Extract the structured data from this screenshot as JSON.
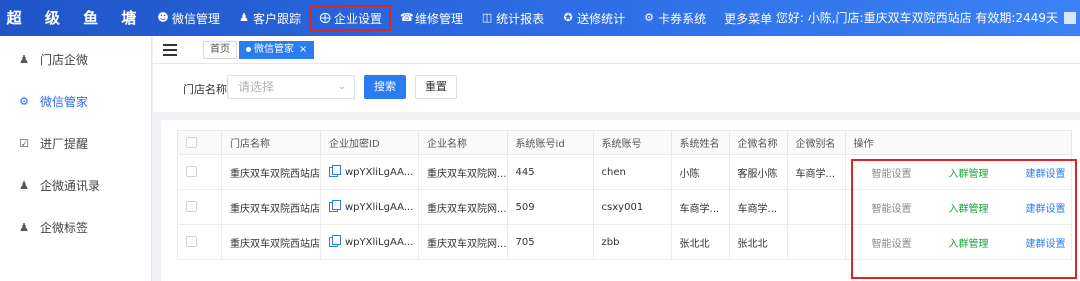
{
  "app": {
    "brand": "超 级 鱼 塘"
  },
  "nav": [
    {
      "label": "微信管理",
      "icon": "users-icon"
    },
    {
      "label": "客户跟踪",
      "icon": "user-icon"
    },
    {
      "label": "企业设置",
      "icon": "plus-circle-icon"
    },
    {
      "label": "维修管理",
      "icon": "wrench-icon"
    },
    {
      "label": "统计报表",
      "icon": "report-icon"
    },
    {
      "label": "送修统计",
      "icon": "share-icon"
    },
    {
      "label": "卡券系统",
      "icon": "ticket-icon"
    },
    {
      "label": "更多菜单",
      "icon": ""
    }
  ],
  "header": {
    "greeting": "您好: 小陈,门店:重庆双车双院西站店 有效期:2449天"
  },
  "sidebar": {
    "items": [
      {
        "label": "门店企微",
        "icon": "person-icon"
      },
      {
        "label": "微信管家",
        "icon": "gear-icon"
      },
      {
        "label": "进厂提醒",
        "icon": "checkbox-icon"
      },
      {
        "label": "企微通讯录",
        "icon": "contacts-icon"
      },
      {
        "label": "企微标签",
        "icon": "tag-icon"
      }
    ]
  },
  "tabs": [
    {
      "label": "首页"
    },
    {
      "label": "微信管家",
      "close": "×"
    }
  ],
  "filter": {
    "label": "门店名称",
    "placeholder": "请选择",
    "search_label": "搜索",
    "reset_label": "重置"
  },
  "table": {
    "columns": [
      "门店名称",
      "企业加密ID",
      "企业名称",
      "系统账号id",
      "系统账号",
      "系统姓名",
      "企微名称",
      "企微别名",
      "操作"
    ],
    "rows": [
      {
        "store": "重庆双车双院西站店",
        "corp_id": "wpYXliLgAA...",
        "corp_name": "重庆双车双院网...",
        "account_id": "445",
        "account": "chen",
        "name": "小陈",
        "wecom_name": "客服小陈",
        "wecom_alias": "车商学..."
      },
      {
        "store": "重庆双车双院西站店",
        "corp_id": "wpYXliLgAA...",
        "corp_name": "重庆双车双院网...",
        "account_id": "509",
        "account": "csxy001",
        "name": "车商学...",
        "wecom_name": "车商学...",
        "wecom_alias": ""
      },
      {
        "store": "重庆双车双院西站店",
        "corp_id": "wpYXliLgAA...",
        "corp_name": "重庆双车双院网...",
        "account_id": "705",
        "account": "zbb",
        "name": "张北北",
        "wecom_name": "张北北",
        "wecom_alias": ""
      }
    ],
    "actions": {
      "smart": "智能设置",
      "join": "入群管理",
      "build": "建群设置"
    }
  },
  "colors": {
    "brand_blue": "#2b7cf0",
    "highlight_red": "#e02424",
    "action_green": "#19a33d"
  }
}
